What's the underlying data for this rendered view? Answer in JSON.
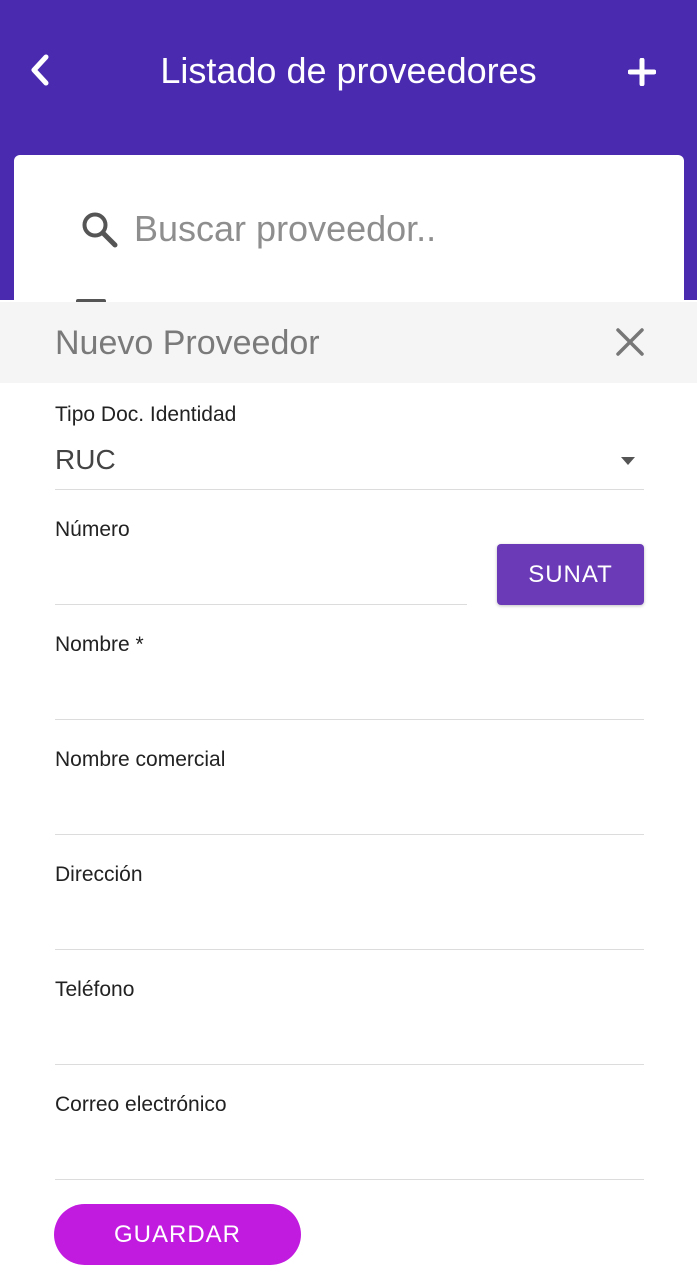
{
  "header": {
    "title": "Listado de proveedores",
    "background": "#4a2bb0"
  },
  "search": {
    "placeholder": "Buscar proveedor.."
  },
  "modal": {
    "title": "Nuevo Proveedor",
    "fields": {
      "doc_type": {
        "label": "Tipo Doc. Identidad",
        "value": "RUC"
      },
      "number": {
        "label": "Número",
        "value": ""
      },
      "name": {
        "label": "Nombre *",
        "value": ""
      },
      "trade_name": {
        "label": "Nombre comercial",
        "value": ""
      },
      "address": {
        "label": "Dirección",
        "value": ""
      },
      "phone": {
        "label": "Teléfono",
        "value": ""
      },
      "email": {
        "label": "Correo electrónico",
        "value": ""
      }
    },
    "sunat_label": "SUNAT",
    "save_label": "GUARDAR"
  },
  "colors": {
    "primary": "#4a2bb0",
    "sunat_button": "#6a3ab7",
    "save_button": "#c21be0"
  },
  "icons": {
    "back": "chevron-left-icon",
    "add": "plus-icon",
    "search": "search-icon",
    "close": "close-icon",
    "dropdown": "caret-down-icon"
  }
}
